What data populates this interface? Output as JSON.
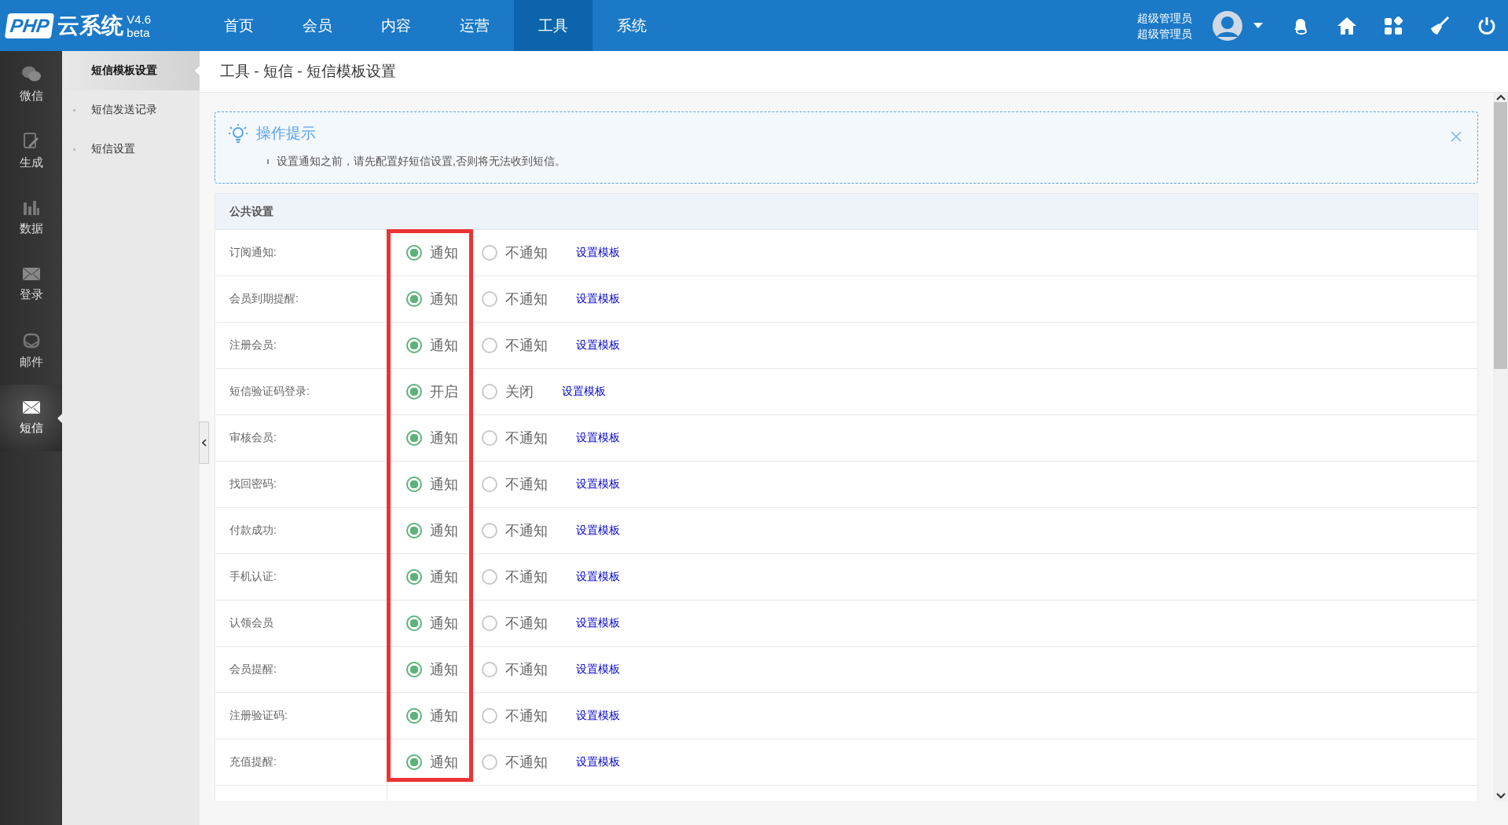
{
  "header": {
    "logo": {
      "brand": "PHP",
      "name": "云系统",
      "version": "V4.6",
      "tag": "beta"
    },
    "nav": [
      {
        "label": "首页",
        "selected": false
      },
      {
        "label": "会员",
        "selected": false
      },
      {
        "label": "内容",
        "selected": false
      },
      {
        "label": "运营",
        "selected": false
      },
      {
        "label": "工具",
        "selected": true
      },
      {
        "label": "系统",
        "selected": false
      }
    ],
    "user": {
      "name": "超级管理员",
      "role": "超级管理员"
    },
    "actions": [
      {
        "kind": "bell"
      },
      {
        "kind": "home"
      },
      {
        "kind": "apps"
      },
      {
        "kind": "broom"
      },
      {
        "kind": "power"
      }
    ]
  },
  "sidebar": {
    "items": [
      {
        "label": "微信",
        "selected": false
      },
      {
        "label": "生成",
        "selected": false
      },
      {
        "label": "数据",
        "selected": false
      },
      {
        "label": "登录",
        "selected": false
      },
      {
        "label": "邮件",
        "selected": false
      },
      {
        "label": "短信",
        "selected": true
      }
    ]
  },
  "subnav": {
    "items": [
      {
        "label": "短信模板设置",
        "selected": true
      },
      {
        "label": "短信发送记录",
        "selected": false
      },
      {
        "label": "短信设置",
        "selected": false
      }
    ]
  },
  "breadcrumb": "工具 - 短信 - 短信模板设置",
  "tip": {
    "title": "操作提示",
    "items": [
      "设置通知之前，请先配置好短信设置,否则将无法收到短信。"
    ]
  },
  "section": {
    "title": "公共设置",
    "rows": [
      {
        "label": "订阅通知:",
        "options": [
          {
            "label": "通知",
            "selected": true
          },
          {
            "label": "不通知",
            "selected": false
          }
        ],
        "link": "设置模板"
      },
      {
        "label": "会员到期提醒:",
        "options": [
          {
            "label": "通知",
            "selected": true
          },
          {
            "label": "不通知",
            "selected": false
          }
        ],
        "link": "设置模板"
      },
      {
        "label": "注册会员:",
        "options": [
          {
            "label": "通知",
            "selected": true
          },
          {
            "label": "不通知",
            "selected": false
          }
        ],
        "link": "设置模板"
      },
      {
        "label": "短信验证码登录:",
        "options": [
          {
            "label": "开启",
            "selected": true
          },
          {
            "label": "关闭",
            "selected": false
          }
        ],
        "link": "设置模板"
      },
      {
        "label": "审核会员:",
        "options": [
          {
            "label": "通知",
            "selected": true
          },
          {
            "label": "不通知",
            "selected": false
          }
        ],
        "link": "设置模板"
      },
      {
        "label": "找回密码:",
        "options": [
          {
            "label": "通知",
            "selected": true
          },
          {
            "label": "不通知",
            "selected": false
          }
        ],
        "link": "设置模板"
      },
      {
        "label": "付款成功:",
        "options": [
          {
            "label": "通知",
            "selected": true
          },
          {
            "label": "不通知",
            "selected": false
          }
        ],
        "link": "设置模板"
      },
      {
        "label": "手机认证:",
        "options": [
          {
            "label": "通知",
            "selected": true
          },
          {
            "label": "不通知",
            "selected": false
          }
        ],
        "link": "设置模板"
      },
      {
        "label": "认领会员",
        "options": [
          {
            "label": "通知",
            "selected": true
          },
          {
            "label": "不通知",
            "selected": false
          }
        ],
        "link": "设置模板"
      },
      {
        "label": "会员提醒:",
        "options": [
          {
            "label": "通知",
            "selected": true
          },
          {
            "label": "不通知",
            "selected": false
          }
        ],
        "link": "设置模板"
      },
      {
        "label": "注册验证码:",
        "options": [
          {
            "label": "通知",
            "selected": true
          },
          {
            "label": "不通知",
            "selected": false
          }
        ],
        "link": "设置模板"
      },
      {
        "label": "充值提醒:",
        "options": [
          {
            "label": "通知",
            "selected": true
          },
          {
            "label": "不通知",
            "selected": false
          }
        ],
        "link": "设置模板"
      }
    ]
  }
}
